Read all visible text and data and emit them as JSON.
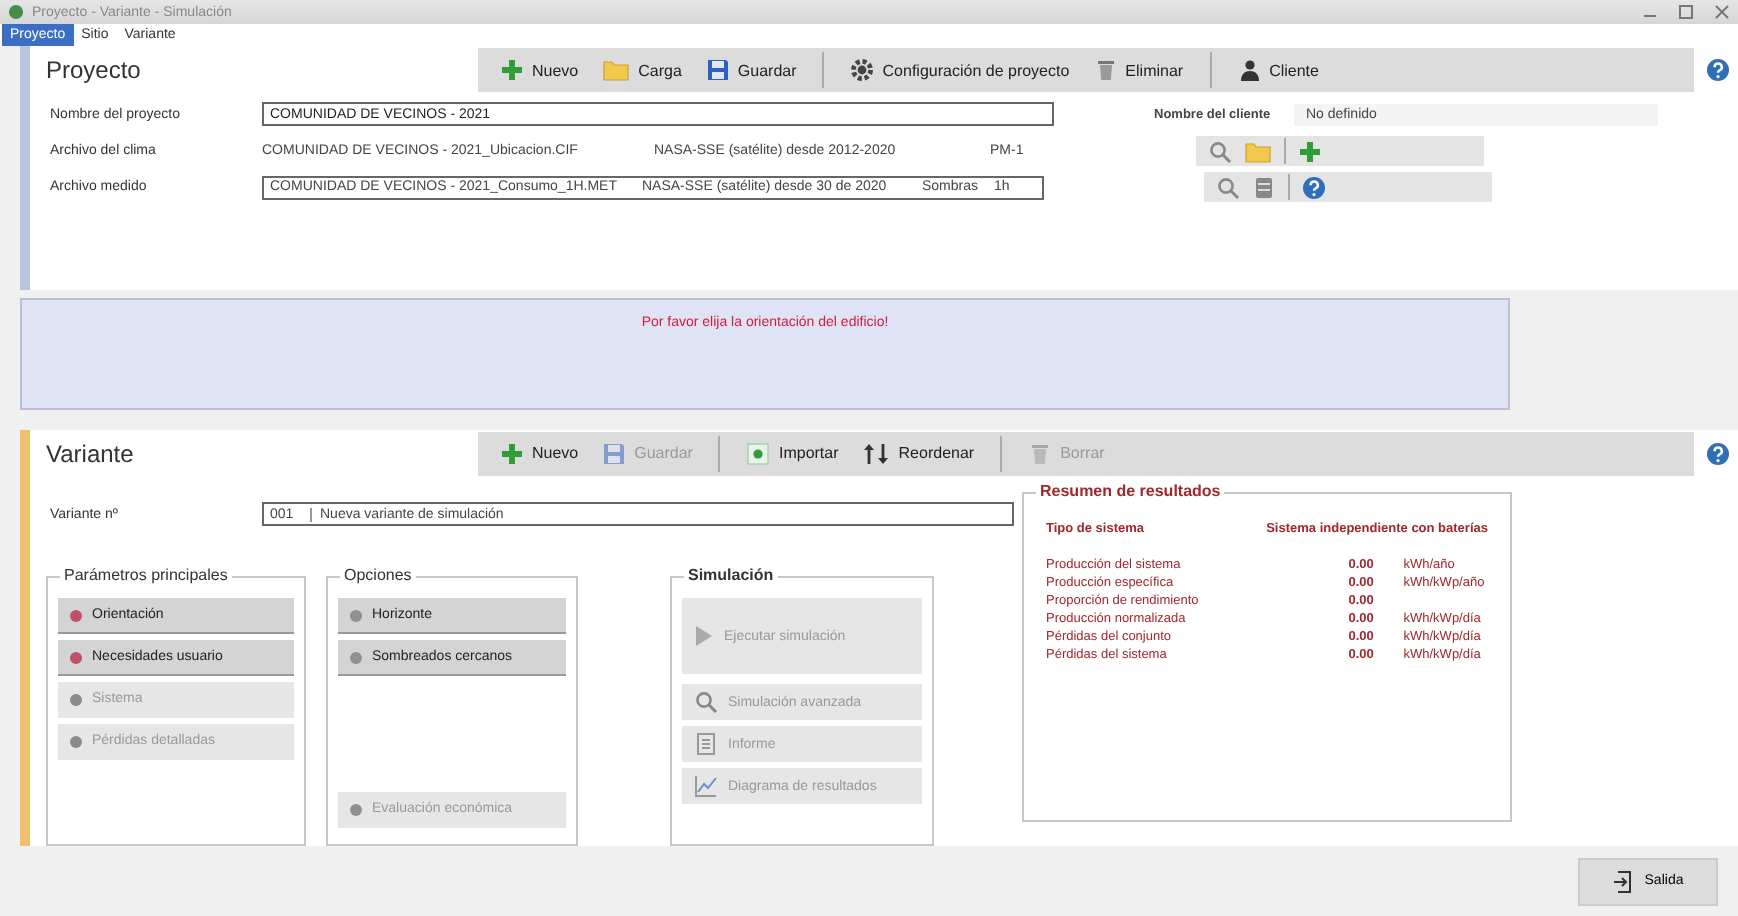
{
  "window": {
    "title": "Proyecto - Variante - Simulación"
  },
  "tabs": [
    {
      "label": "Proyecto",
      "selected": true
    },
    {
      "label": "Sitio",
      "selected": false
    },
    {
      "label": "Variante",
      "selected": false
    }
  ],
  "project": {
    "title": "Proyecto",
    "toolbar": [
      {
        "kind": "add",
        "label": "Nuevo",
        "disabled": false
      },
      {
        "kind": "open",
        "label": "Carga",
        "disabled": false
      },
      {
        "kind": "save",
        "label": "Guardar",
        "disabled": false
      },
      {
        "kind": "sep"
      },
      {
        "kind": "settings",
        "label": "Configuración de proyecto",
        "disabled": false
      },
      {
        "kind": "delete",
        "label": "Eliminar",
        "disabled": false
      },
      {
        "kind": "sep"
      },
      {
        "kind": "person",
        "label": "Cliente",
        "disabled": false
      }
    ],
    "name_label": "Nombre del proyecto",
    "name_value": "COMUNIDAD DE VECINOS - 2021",
    "client_label": "Nombre del cliente",
    "client_value": "No definido",
    "climate_label": "Archivo del clima",
    "climate_file": "COMUNIDAD DE VECINOS - 2021_Ubicacion.CIF",
    "climate_source": "NASA-SSE (satélite) desde 2012-2020",
    "climate_step": "PM-1",
    "meter_label": "Archivo medido",
    "meter_file": "COMUNIDAD DE VECINOS - 2021_Consumo_1H.MET",
    "meter_source": "NASA-SSE (satélite) desde 30 de 2020",
    "meter_type": "Sombras",
    "meter_step": "1h"
  },
  "banner": "Por favor elija la orientación del edificio!",
  "variant": {
    "title": "Variante",
    "toolbar": [
      {
        "kind": "add",
        "label": "Nuevo",
        "disabled": false
      },
      {
        "kind": "save",
        "label": "Guardar",
        "disabled": true
      },
      {
        "kind": "sep"
      },
      {
        "kind": "import",
        "label": "Importar",
        "disabled": false
      },
      {
        "kind": "sort",
        "label": "Reordenar",
        "disabled": false
      },
      {
        "kind": "sep"
      },
      {
        "kind": "delete",
        "label": "Borrar",
        "disabled": true
      }
    ],
    "number_label": "Variante nº",
    "number": "001",
    "description": "Nueva variante de simulación",
    "groups": [
      {
        "title": "Parámetros principales",
        "items": [
          {
            "label": "Orientación",
            "disabled": false
          },
          {
            "label": "Necesidades usuario",
            "disabled": false
          },
          {
            "label": "Sistema",
            "disabled": true
          },
          {
            "label": "Pérdidas detalladas",
            "disabled": true
          }
        ]
      },
      {
        "title": "Opciones",
        "items": [
          {
            "label": "Horizonte",
            "disabled": false
          },
          {
            "label": "Sombreados cercanos",
            "disabled": false
          }
        ],
        "footer": [
          {
            "label": "Evaluación económica",
            "disabled": true
          }
        ]
      }
    ],
    "simulation": {
      "title": "Simulación",
      "items": [
        {
          "kind": "run",
          "label": "Ejecutar simulación",
          "disabled": true
        },
        {
          "kind": "search",
          "label": "Simulación avanzada",
          "disabled": true
        },
        {
          "kind": "report",
          "label": "Informe",
          "disabled": true
        },
        {
          "kind": "chart",
          "label": "Diagrama de resultados",
          "disabled": true
        }
      ]
    },
    "results": {
      "title": "Resumen de resultados",
      "col_1": "Tipo de sistema",
      "col_2": "Sistema independiente con baterías",
      "rows": [
        {
          "label": "Producción del sistema",
          "value": "0.00",
          "unit": "kWh/año"
        },
        {
          "label": "Producción específica",
          "value": "0.00",
          "unit": "kWh/kWp/año"
        },
        {
          "label": "Proporción de rendimiento",
          "value": "0.00"
        },
        {
          "label": "Producción normalizada",
          "value": "0.00",
          "unit": "kWh/kWp/día"
        },
        {
          "label": "Pérdidas del conjunto",
          "value": "0.00",
          "unit": "kWh/kWp/día"
        },
        {
          "label": "Pérdidas del sistema",
          "value": "0.00",
          "unit": "kWh/kWp/día"
        }
      ]
    }
  },
  "footer": {
    "exit": "Salida"
  }
}
